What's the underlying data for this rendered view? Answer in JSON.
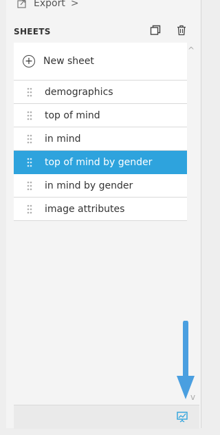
{
  "export": {
    "label": "Export",
    "chevron": ">"
  },
  "sheets": {
    "title": "SHEETS",
    "new_sheet_label": "New sheet",
    "items": [
      {
        "label": "demographics",
        "selected": false
      },
      {
        "label": "top of mind",
        "selected": false
      },
      {
        "label": "in mind",
        "selected": false
      },
      {
        "label": "top of mind by gender",
        "selected": true
      },
      {
        "label": "in mind by gender",
        "selected": false
      },
      {
        "label": "image attributes",
        "selected": false
      }
    ]
  },
  "colors": {
    "accent": "#2ea3dd",
    "arrow": "#4a9fe0",
    "present_icon": "#2ea3dd"
  },
  "icons": {
    "export": "export-icon",
    "copy": "copy-icon",
    "trash": "trash-icon",
    "plus": "plus-circle-icon",
    "grip": "drag-handle-icon",
    "present": "presentation-icon"
  }
}
